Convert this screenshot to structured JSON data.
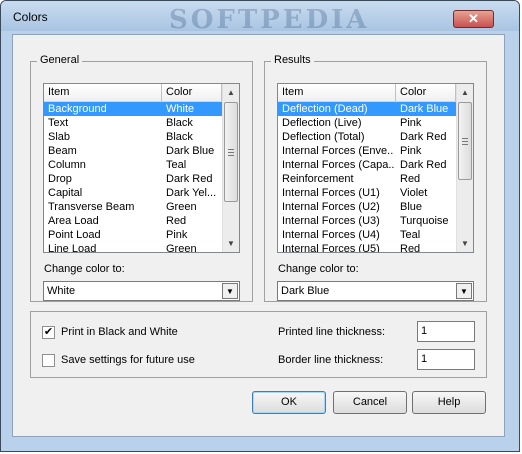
{
  "window": {
    "title": "Colors",
    "watermark": "SOFTPEDIA",
    "close_glyph": "✕"
  },
  "general": {
    "label": "General",
    "columns": [
      "Item",
      "Color"
    ],
    "rows": [
      {
        "item": "Background",
        "color": "White",
        "selected": true
      },
      {
        "item": "Text",
        "color": "Black"
      },
      {
        "item": "Slab",
        "color": "Black"
      },
      {
        "item": "Beam",
        "color": "Dark Blue"
      },
      {
        "item": "Column",
        "color": "Teal"
      },
      {
        "item": "Drop",
        "color": "Dark Red"
      },
      {
        "item": "Capital",
        "color": "Dark Yel..."
      },
      {
        "item": "Transverse Beam",
        "color": "Green"
      },
      {
        "item": "Area Load",
        "color": "Red"
      },
      {
        "item": "Point Load",
        "color": "Pink"
      },
      {
        "item": "Line Load",
        "color": "Green"
      }
    ],
    "change_label": "Change color to:",
    "change_value": "White"
  },
  "results": {
    "label": "Results",
    "columns": [
      "Item",
      "Color"
    ],
    "rows": [
      {
        "item": "Deflection (Dead)",
        "color": "Dark Blue",
        "selected": true
      },
      {
        "item": "Deflection (Live)",
        "color": "Pink"
      },
      {
        "item": "Deflection (Total)",
        "color": "Dark Red"
      },
      {
        "item": "Internal Forces (Enve...",
        "color": "Pink"
      },
      {
        "item": "Internal Forces (Capa...",
        "color": "Dark Red"
      },
      {
        "item": "Reinforcement",
        "color": "Red"
      },
      {
        "item": "Internal Forces (U1)",
        "color": "Violet"
      },
      {
        "item": "Internal Forces (U2)",
        "color": "Blue"
      },
      {
        "item": "Internal Forces (U3)",
        "color": "Turquoise"
      },
      {
        "item": "Internal Forces (U4)",
        "color": "Teal"
      },
      {
        "item": "Internal Forces (U5)",
        "color": "Red"
      }
    ],
    "change_label": "Change color to:",
    "change_value": "Dark Blue"
  },
  "options": {
    "print_bw": {
      "label": "Print in Black and White",
      "checked": true,
      "check_glyph": "✔"
    },
    "save_settings": {
      "label": "Save settings for future use",
      "checked": false
    },
    "printed_line": {
      "label": "Printed line thickness:",
      "value": "1"
    },
    "border_line": {
      "label": "Border line thickness:",
      "value": "1"
    }
  },
  "buttons": {
    "ok": "OK",
    "cancel": "Cancel",
    "help": "Help"
  },
  "icons": {
    "scroll_up": "▲",
    "scroll_down": "▼",
    "dropdown": "▼"
  }
}
